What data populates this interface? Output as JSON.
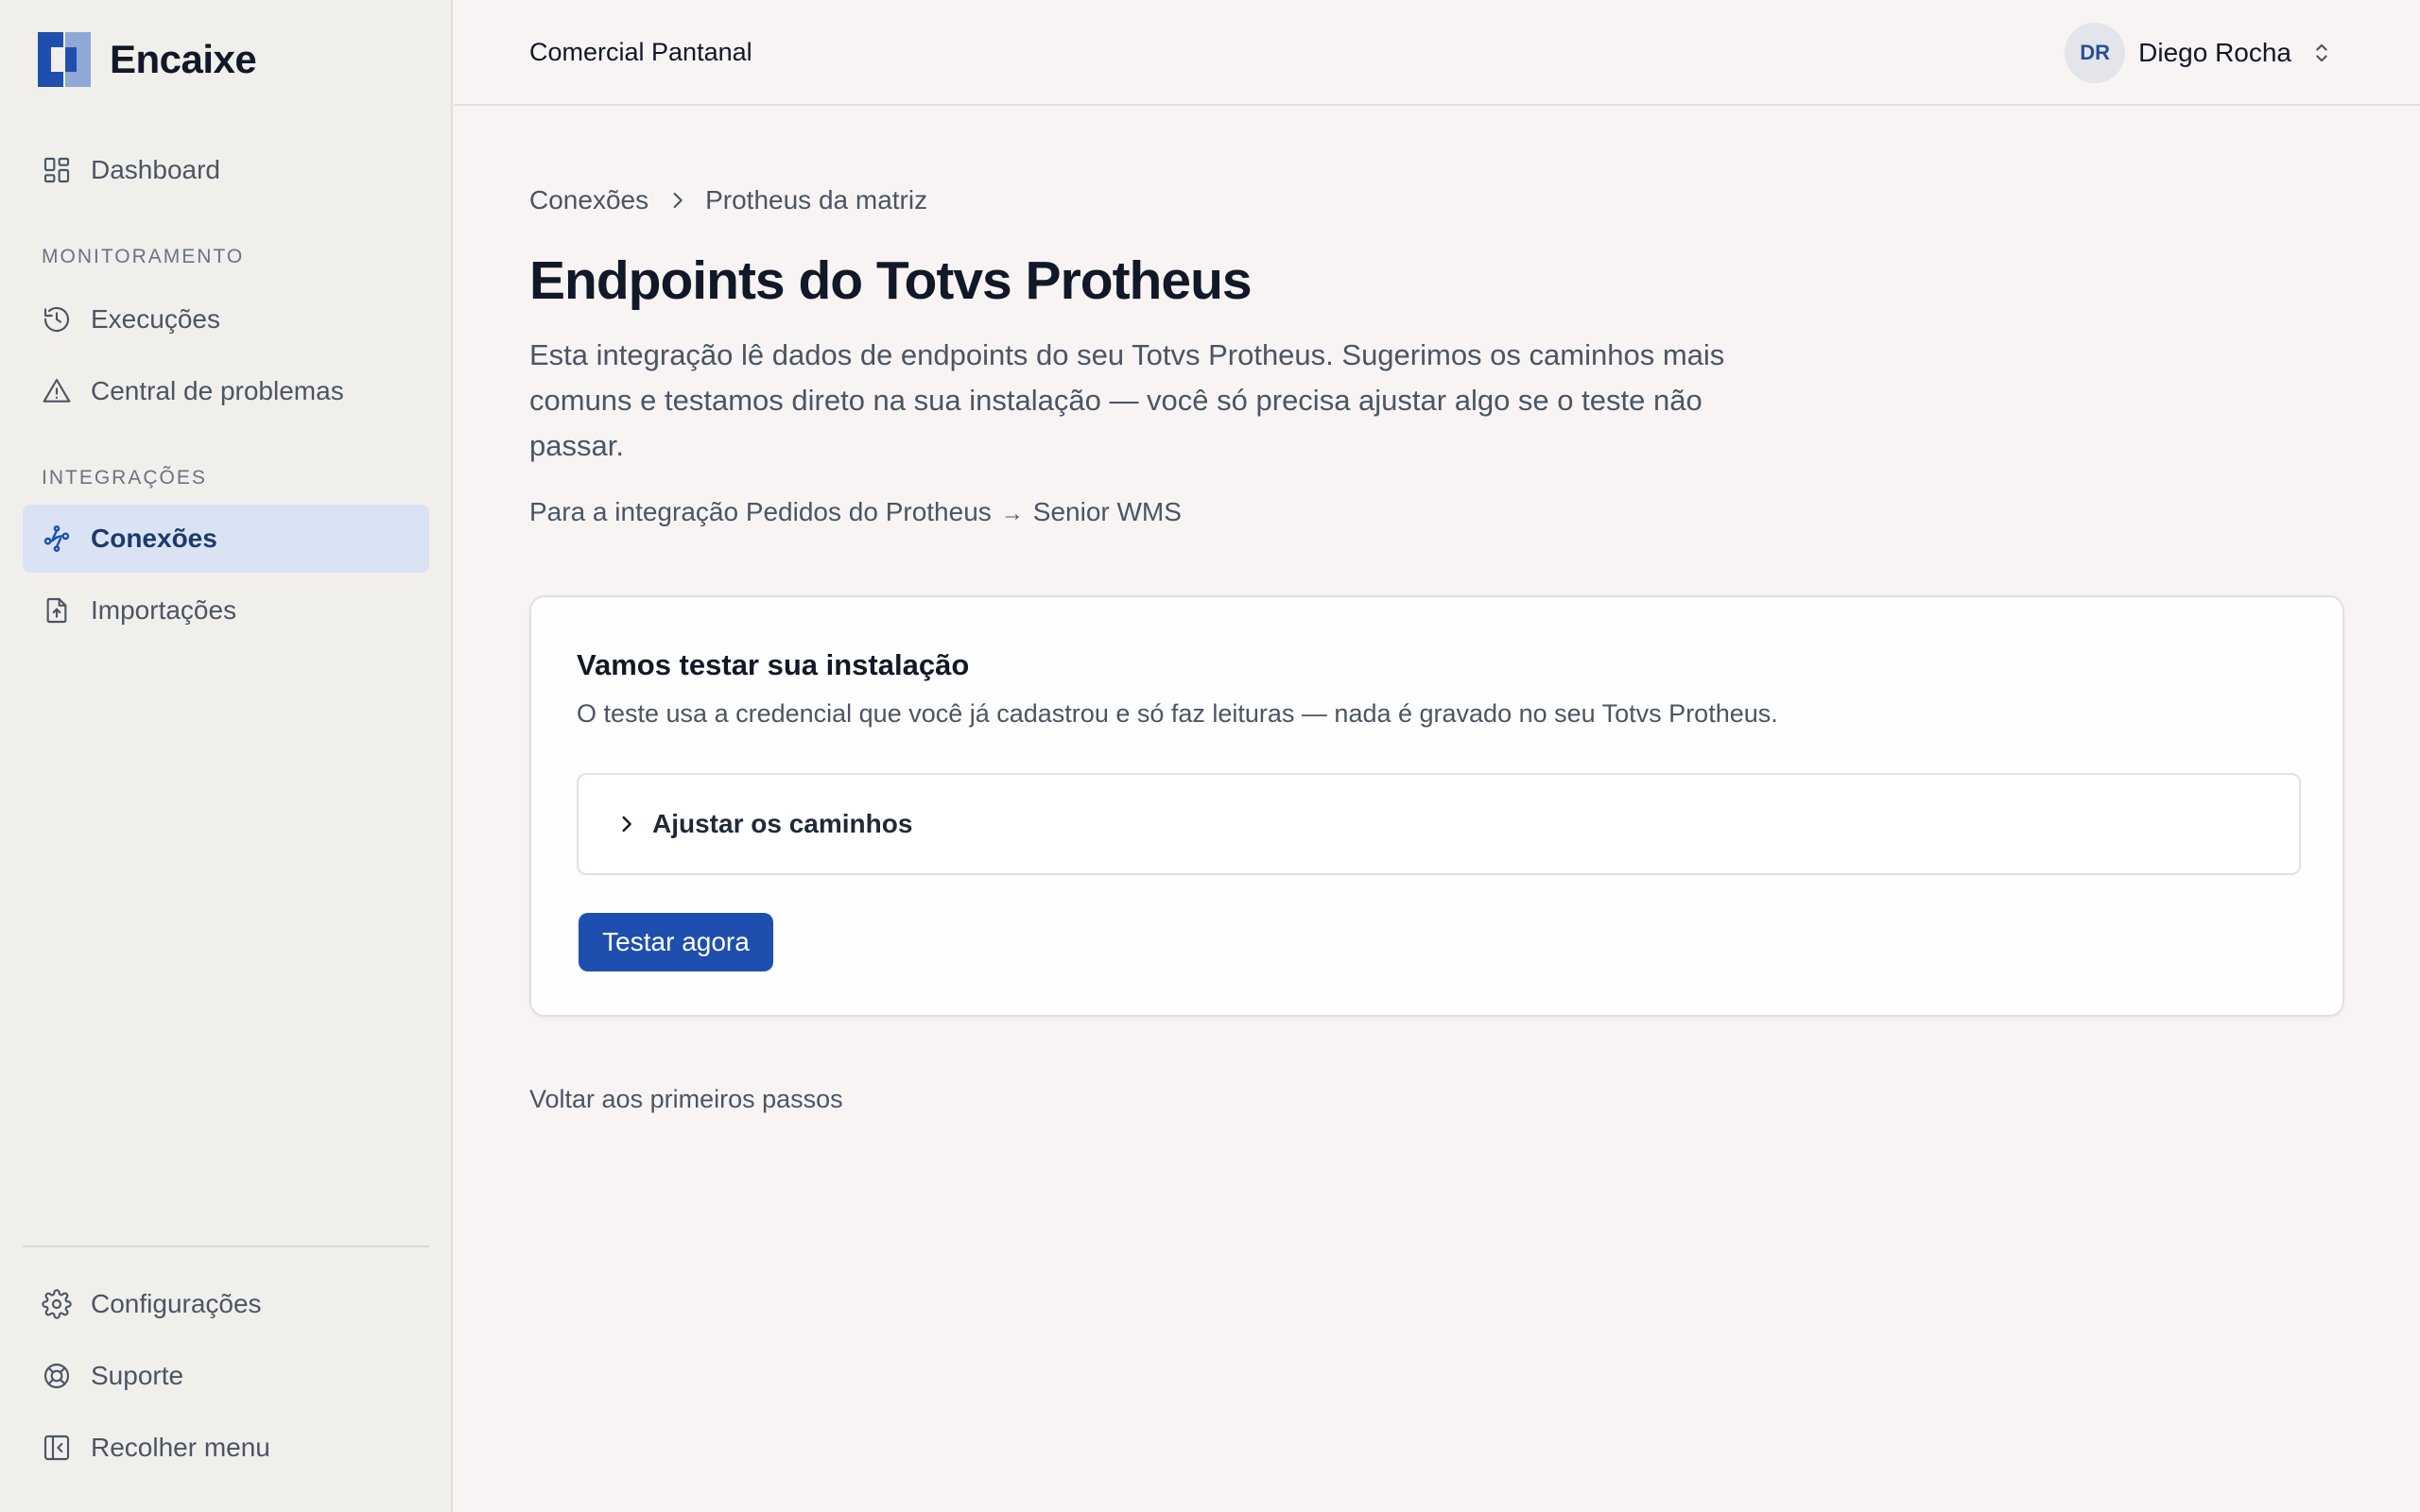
{
  "app": {
    "name": "Encaixe",
    "brand_color": "#1f4fae"
  },
  "sidebar": {
    "dashboard": {
      "label": "Dashboard",
      "icon": "grid-icon"
    },
    "sections": {
      "monitoring": "MONITORAMENTO",
      "integrations": "INTEGRAÇÕES"
    },
    "monitoring_items": [
      {
        "label": "Execuções",
        "icon": "history-icon"
      },
      {
        "label": "Central de problemas",
        "icon": "warning-icon"
      }
    ],
    "integration_items": [
      {
        "label": "Conexões",
        "icon": "connections-icon",
        "active": true
      },
      {
        "label": "Importações",
        "icon": "file-upload-icon"
      }
    ],
    "footer_items": [
      {
        "label": "Configurações",
        "icon": "gear-icon"
      },
      {
        "label": "Suporte",
        "icon": "lifebuoy-icon"
      },
      {
        "label": "Recolher menu",
        "icon": "collapse-sidebar-icon"
      }
    ]
  },
  "header": {
    "company": "Comercial Pantanal",
    "user": {
      "initials": "DR",
      "name": "Diego Rocha"
    }
  },
  "main": {
    "breadcrumb": [
      "Conexões",
      "Protheus da matriz"
    ],
    "title": "Endpoints do Totvs Protheus",
    "description": "Esta integração lê dados de endpoints do seu Totvs Protheus. Sugerimos os caminhos mais comuns e testamos direto na sua instalação — você só precisa ajustar algo se o teste não passar.",
    "integration": {
      "prefix": "Para a integração Pedidos do Protheus",
      "arrow": "→",
      "target": "Senior WMS"
    },
    "card": {
      "title": "Vamos testar sua instalação",
      "subtitle": "O teste usa a credencial que você já cadastrou e só faz leituras — nada é gravado no seu Totvs Protheus.",
      "accordion_label": "Ajustar os caminhos",
      "button_label": "Testar agora"
    },
    "back_link": "Voltar aos primeiros passos"
  }
}
